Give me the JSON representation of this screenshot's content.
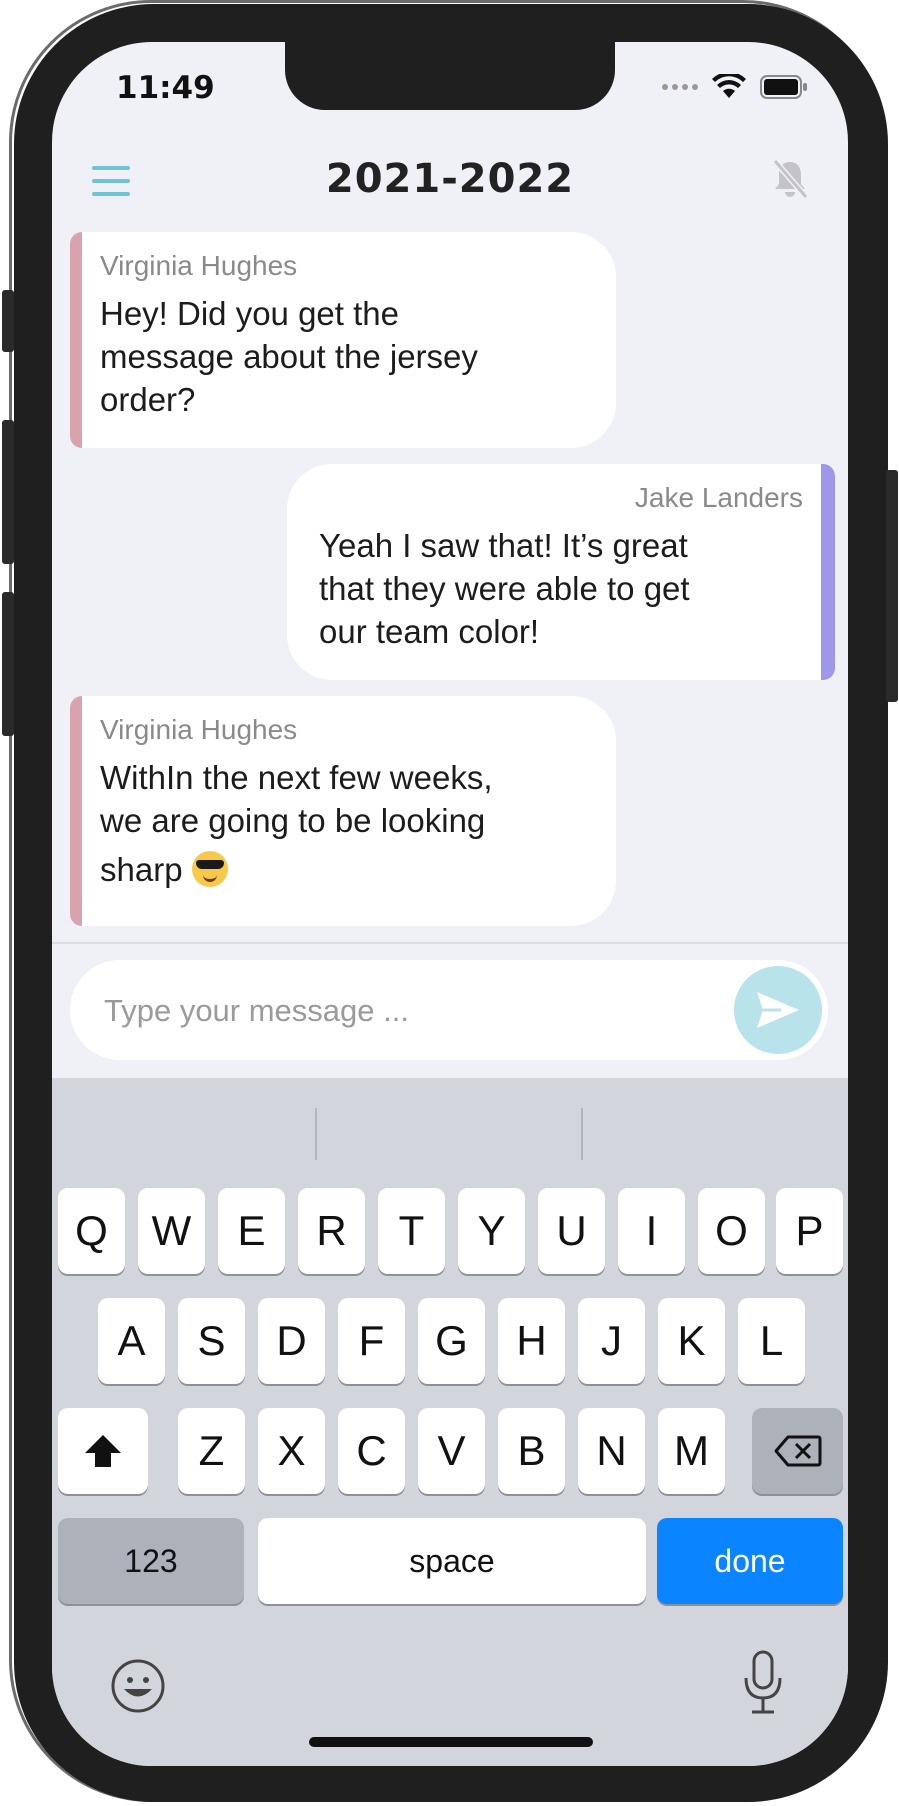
{
  "status_bar": {
    "time": "11:49"
  },
  "header": {
    "title": "2021-2022"
  },
  "messages": [
    {
      "sender": "Virginia Hughes",
      "lines": [
        "Hey! Did you get the",
        "message about the jersey",
        "order?"
      ],
      "side": "left"
    },
    {
      "sender": "Jake Landers",
      "lines": [
        "Yeah I saw that! It’s great",
        "that they were able to get",
        "our team color!"
      ],
      "side": "right"
    },
    {
      "sender": "Virginia Hughes",
      "lines": [
        "WithIn the next few weeks,",
        "we are going to be looking",
        "sharp"
      ],
      "emoji": "smiling-face-with-sunglasses",
      "side": "left"
    }
  ],
  "composer": {
    "placeholder": "Type your message ..."
  },
  "keyboard": {
    "row1": [
      "Q",
      "W",
      "E",
      "R",
      "T",
      "Y",
      "U",
      "I",
      "O",
      "P"
    ],
    "row2": [
      "A",
      "S",
      "D",
      "F",
      "G",
      "H",
      "J",
      "K",
      "L"
    ],
    "row3": [
      "Z",
      "X",
      "C",
      "V",
      "B",
      "N",
      "M"
    ],
    "numbers_label": "123",
    "space_label": "space",
    "done_label": "done"
  },
  "colors": {
    "accent": "#6ec3d8",
    "left_bubble_bar": "#d8a3ad",
    "right_bubble_bar": "#9f98ea",
    "done_key": "#0a84ff"
  },
  "icons": [
    "menu-icon",
    "bell-muted-icon",
    "send-icon",
    "shift-icon",
    "backspace-icon",
    "emoji-icon",
    "microphone-icon",
    "wifi-icon",
    "battery-icon"
  ]
}
